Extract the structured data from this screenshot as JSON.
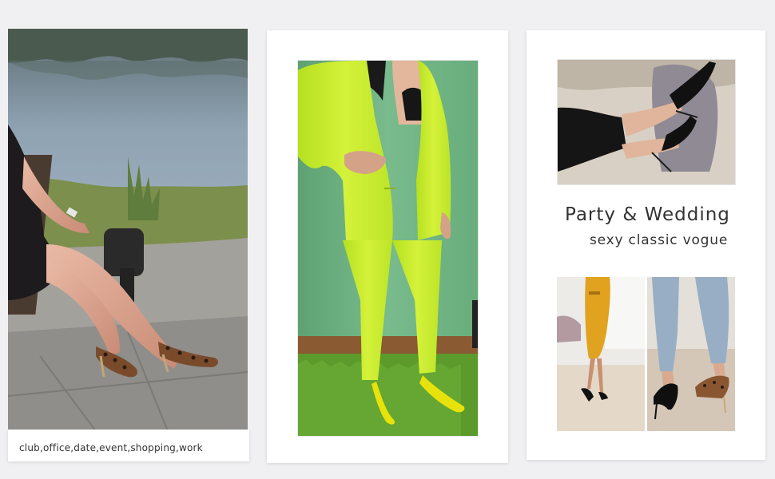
{
  "colors": {
    "page_background": "#f0f0f2",
    "card_background": "#ffffff",
    "text": "#333333",
    "suit_accent": "#c6ec2b",
    "shoe_yellow": "#e8e20c",
    "dress_mustard": "#e0a21f"
  },
  "caption": {
    "text": "club,office,date,event,shopping,work"
  },
  "right_card": {
    "title": "Party & Wedding",
    "subtitle": "sexy classic vogue"
  },
  "photos": [
    {
      "icon": "photo-woman-leopard-heels-bench"
    },
    {
      "icon": "photo-woman-lime-suit-yellow-heels"
    },
    {
      "icon": "photo-black-heels-on-sofa"
    },
    {
      "icon": "photo-mustard-dress-black-heels"
    },
    {
      "icon": "photo-jeans-black-and-leopard-heels"
    }
  ]
}
